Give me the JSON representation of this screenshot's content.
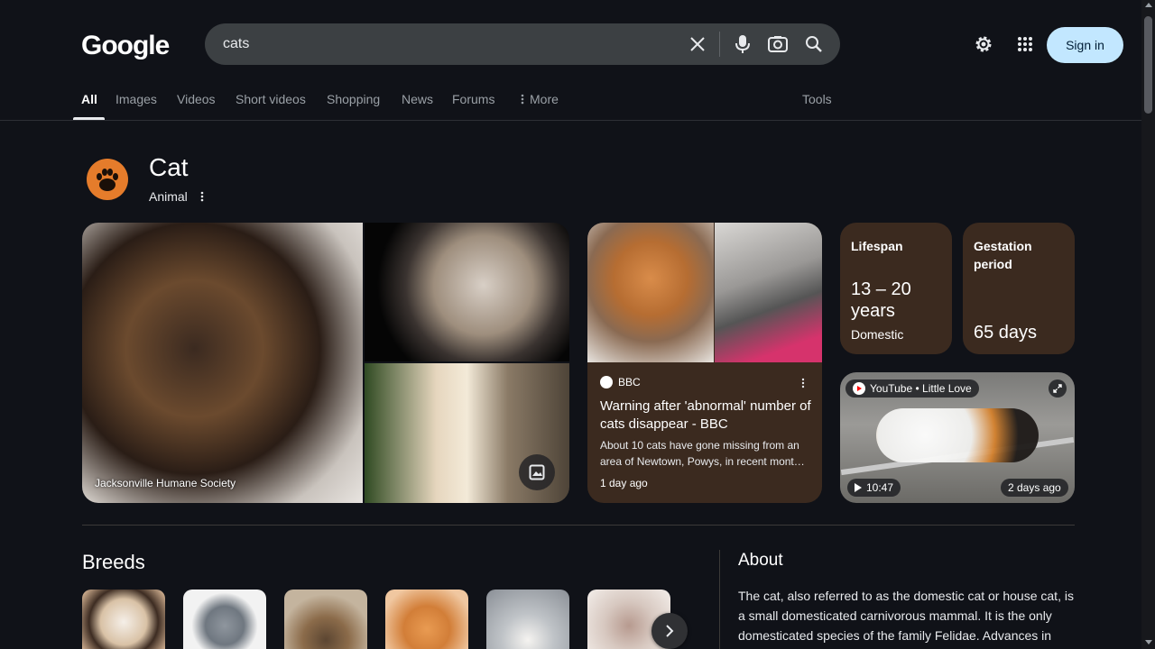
{
  "header": {
    "logo_text": "Google",
    "search_value": "cats",
    "signin_label": "Sign in"
  },
  "tabs": [
    {
      "label": "All",
      "active": true
    },
    {
      "label": "Images"
    },
    {
      "label": "Videos"
    },
    {
      "label": "Short videos"
    },
    {
      "label": "Shopping"
    },
    {
      "label": "News"
    },
    {
      "label": "Forums"
    },
    {
      "label": "More"
    }
  ],
  "tools_label": "Tools",
  "entity": {
    "title": "Cat",
    "subtitle": "Animal"
  },
  "collage": {
    "caption": "Jacksonville Humane Society"
  },
  "news_card": {
    "source": "BBC",
    "title": "Warning after 'abnormal' number of cats disappear - BBC",
    "snippet": "About 10 cats have gone missing from an area of Newtown, Powys, in recent mont…",
    "time": "1 day ago"
  },
  "stats": [
    {
      "label": "Lifespan",
      "value": "13 – 20 years",
      "sub": "Domestic"
    },
    {
      "label": "Gestation period",
      "value": "65 days"
    }
  ],
  "video_card": {
    "source": "YouTube • Little Love",
    "duration": "10:47",
    "age": "2 days ago"
  },
  "breeds": {
    "title": "Breeds",
    "swatches": [
      "#c9a98b",
      "#f2f2f2",
      "#c4b49e",
      "#e1965a",
      "#bfc3c7",
      "#d7c8c0"
    ]
  },
  "about": {
    "title": "About",
    "text": "The cat, also referred to as the domestic cat or house cat, is a small domesticated carnivorous mammal. It is the only domesticated species of the family Felidae. Advances in"
  },
  "colors": {
    "background": "#101218",
    "card_brown": "#3b2a1f",
    "signin_bg": "#c2e7ff",
    "entity_icon": "#e57c2b"
  }
}
